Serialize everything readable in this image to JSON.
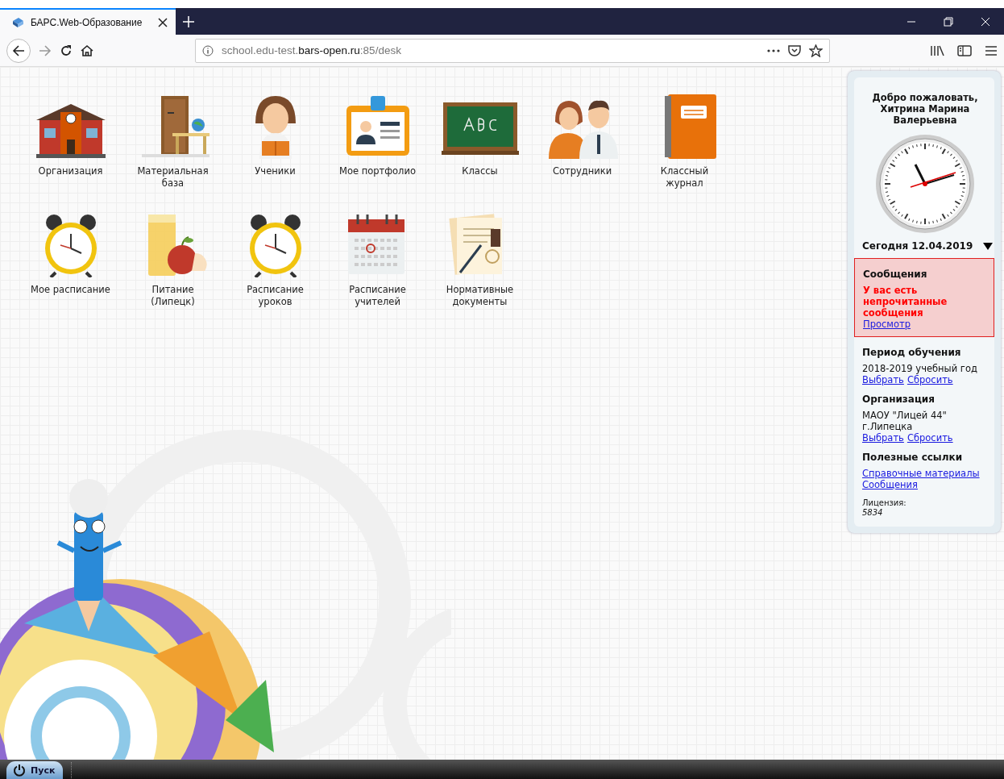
{
  "browser": {
    "tab_title": "БАРС.Web-Образование",
    "url_host_prefix": "school.edu-test.",
    "url_host": "bars-open.ru",
    "url_rest": ":85/desk"
  },
  "desktop_icons": [
    {
      "kind": "building",
      "label": "Организация"
    },
    {
      "kind": "door",
      "label": "Материальная база"
    },
    {
      "kind": "student",
      "label": "Ученики"
    },
    {
      "kind": "portfolio",
      "label": "Мое портфолио"
    },
    {
      "kind": "chalkboard",
      "label": "Классы"
    },
    {
      "kind": "staff",
      "label": "Сотрудники"
    },
    {
      "kind": "notebook",
      "label": "Классный журнал"
    },
    {
      "kind": "alarm",
      "label": "Мое расписание"
    },
    {
      "kind": "food",
      "label": "Питание (Липецк)"
    },
    {
      "kind": "alarm",
      "label": "Расписание уроков"
    },
    {
      "kind": "calendar",
      "label": "Расписание учителей"
    },
    {
      "kind": "documents",
      "label": "Нормативные документы"
    }
  ],
  "sidebar": {
    "greeting": "Добро пожаловать, Хитрина Марина Валерьевна",
    "today": "Сегодня 12.04.2019",
    "messages": {
      "title": "Сообщения",
      "alert": "У вас есть непрочитанные сообщения",
      "link": "Просмотр"
    },
    "sections": [
      {
        "title": "Период обучения",
        "lines": [
          "2018-2019 учебный год"
        ],
        "links": [
          "Выбрать",
          "Сбросить"
        ]
      },
      {
        "title": "Организация",
        "lines": [
          "МАОУ \"Лицей 44\" г.Липецка"
        ],
        "links": [
          "Выбрать",
          "Сбросить"
        ]
      },
      {
        "title": "Полезные ссылки",
        "links": [
          "Справочные материалы",
          "Сообщения"
        ]
      }
    ],
    "license_label": "Лицензия:",
    "license_number": "5834"
  },
  "taskbar": {
    "start_label": "Пуск"
  }
}
